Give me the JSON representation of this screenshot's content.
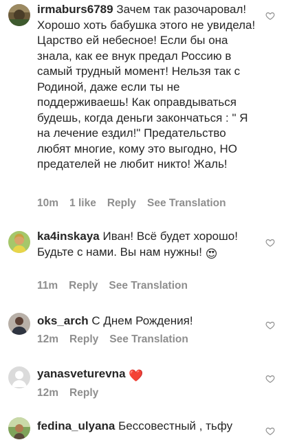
{
  "comments": [
    {
      "username": "irmaburs6789",
      "text": "Зачем так разочаровал! Хорошо хоть бабушка этого не увидела! Царство ей небесное! Если бы она знала, как ее внук предал Россию в самый трудный момент! Нельзя так с Родиной, даже если ты не поддерживаешь!  Как оправдываться будешь, когда деньги закончаться : \" Я на лечение ездил!\" Предательство любят многие, кому это выгодно, НО предателей не любит никто! Жаль!",
      "time": "10m",
      "likes": "1 like",
      "reply": "Reply",
      "translation": "See Translation",
      "avatar_icon": "avatar-landscape-icon"
    },
    {
      "username": "ka4inskaya",
      "text": "Иван! Всё будет хорошо! Будьте с нами. Вы нам нужны!",
      "emoji": "😍",
      "time": "11m",
      "reply": "Reply",
      "translation": "See Translation",
      "avatar_icon": "avatar-portrait-icon"
    },
    {
      "username": "oks_arch",
      "text": "С Днем Рождения!",
      "time": "12m",
      "reply": "Reply",
      "translation": "See Translation",
      "avatar_icon": "avatar-photo-icon"
    },
    {
      "username": "yanasveturevna",
      "text": "",
      "emoji": "❤️",
      "time": "12m",
      "reply": "Reply",
      "avatar_icon": "avatar-default-icon"
    },
    {
      "username": "fedina_ulyana",
      "text": "Бессовестный , тьфу",
      "avatar_icon": "avatar-outdoor-icon"
    }
  ],
  "colors": {
    "text": "#262626",
    "meta": "#8e8e8e",
    "heart_outline": "#8e8e8e"
  }
}
